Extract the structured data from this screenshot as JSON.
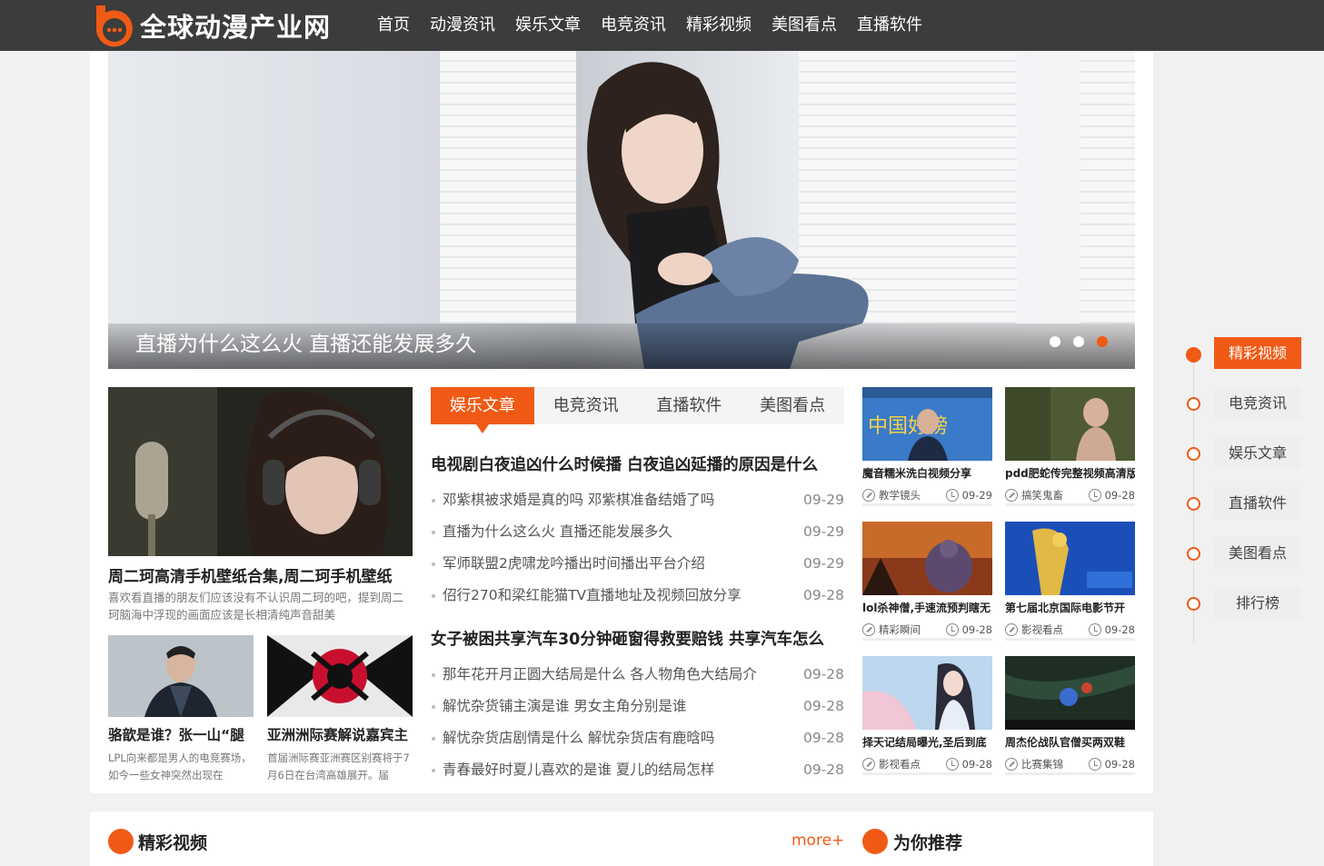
{
  "site": {
    "name": "全球动漫产业网"
  },
  "nav": [
    "首页",
    "动漫资讯",
    "娱乐文章",
    "电竞资讯",
    "精彩视频",
    "美图看点",
    "直播软件"
  ],
  "banner": {
    "title": "直播为什么这么火 直播还能发展多久",
    "active_dot": 3,
    "dots": 3
  },
  "featured": {
    "title": "周二珂高清手机壁纸合集,周二珂手机壁纸",
    "desc": "喜欢看直播的朋友们应该没有不认识周二珂的吧，提到周二珂脑海中浮现的画面应该是长相清纯声音甜美"
  },
  "small_posts": [
    {
      "title": "骆歆是谁？张一山“腿",
      "desc": "LPL向来都是男人的电竞赛场，如今一些女神突然出现在"
    },
    {
      "title": "亚洲洲际赛解说嘉宾主",
      "desc": "首届洲际赛亚洲赛区别赛将于7月6日在台湾高雄展开。届"
    }
  ],
  "tabs": [
    {
      "label": "娱乐文章",
      "active": true
    },
    {
      "label": "电竞资讯",
      "active": false
    },
    {
      "label": "直播软件",
      "active": false
    },
    {
      "label": "美图看点",
      "active": false
    }
  ],
  "news_groups": [
    {
      "head": "电视剧白夜追凶什么时候播 白夜追凶延播的原因是什么",
      "items": [
        {
          "title": "邓紫棋被求婚是真的吗 邓紫棋准备结婚了吗",
          "date": "09-29"
        },
        {
          "title": "直播为什么这么火 直播还能发展多久",
          "date": "09-29"
        },
        {
          "title": "军师联盟2虎啸龙吟播出时间播出平台介绍",
          "date": "09-29"
        },
        {
          "title": "佋行270和梁红能猫TV直播地址及视频回放分享",
          "date": "09-28"
        }
      ]
    },
    {
      "head": "女子被困共享汽车30分钟砸窗得救要赔钱 共享汽车怎么",
      "items": [
        {
          "title": "那年花开月正圆大结局是什么 各人物角色大结局介",
          "date": "09-28"
        },
        {
          "title": "解忧杂货铺主演是谁 男女主角分别是谁",
          "date": "09-28"
        },
        {
          "title": "解忧杂货店剧情是什么 解忧杂货店有鹿晗吗",
          "date": "09-28"
        },
        {
          "title": "青春最好时夏儿喜欢的是谁 夏儿的结局怎样",
          "date": "09-28"
        }
      ]
    }
  ],
  "cards": [
    {
      "title": "魔音糯米洗白视频分享",
      "cat": "教学镜头",
      "date": "09-29",
      "img_text": "中国好榜"
    },
    {
      "title": "pdd肥蛇传完整视频高清版",
      "cat": "搞笑鬼畜",
      "date": "09-28",
      "img_text": ""
    },
    {
      "title": "lol杀神僧,手速流预判瞎无",
      "cat": "精彩瞬间",
      "date": "09-28",
      "img_text": ""
    },
    {
      "title": "第七届北京国际电影节开",
      "cat": "影视看点",
      "date": "09-28",
      "img_text": ""
    },
    {
      "title": "择天记结局曝光,圣后到底",
      "cat": "影视看点",
      "date": "09-28",
      "img_text": ""
    },
    {
      "title": "周杰伦战队官僧买两双鞋",
      "cat": "比赛集锦",
      "date": "09-28",
      "img_text": ""
    }
  ],
  "sections": {
    "video": "精彩视频",
    "more": "more+",
    "recommend": "为你推荐"
  },
  "sidebar": [
    {
      "label": "精彩视频",
      "active": true
    },
    {
      "label": "电竞资讯",
      "active": false
    },
    {
      "label": "娱乐文章",
      "active": false
    },
    {
      "label": "直播软件",
      "active": false
    },
    {
      "label": "美图看点",
      "active": false
    },
    {
      "label": "排行榜",
      "active": false
    }
  ],
  "colors": {
    "accent": "#f05a15",
    "header": "#3c3c3c"
  }
}
